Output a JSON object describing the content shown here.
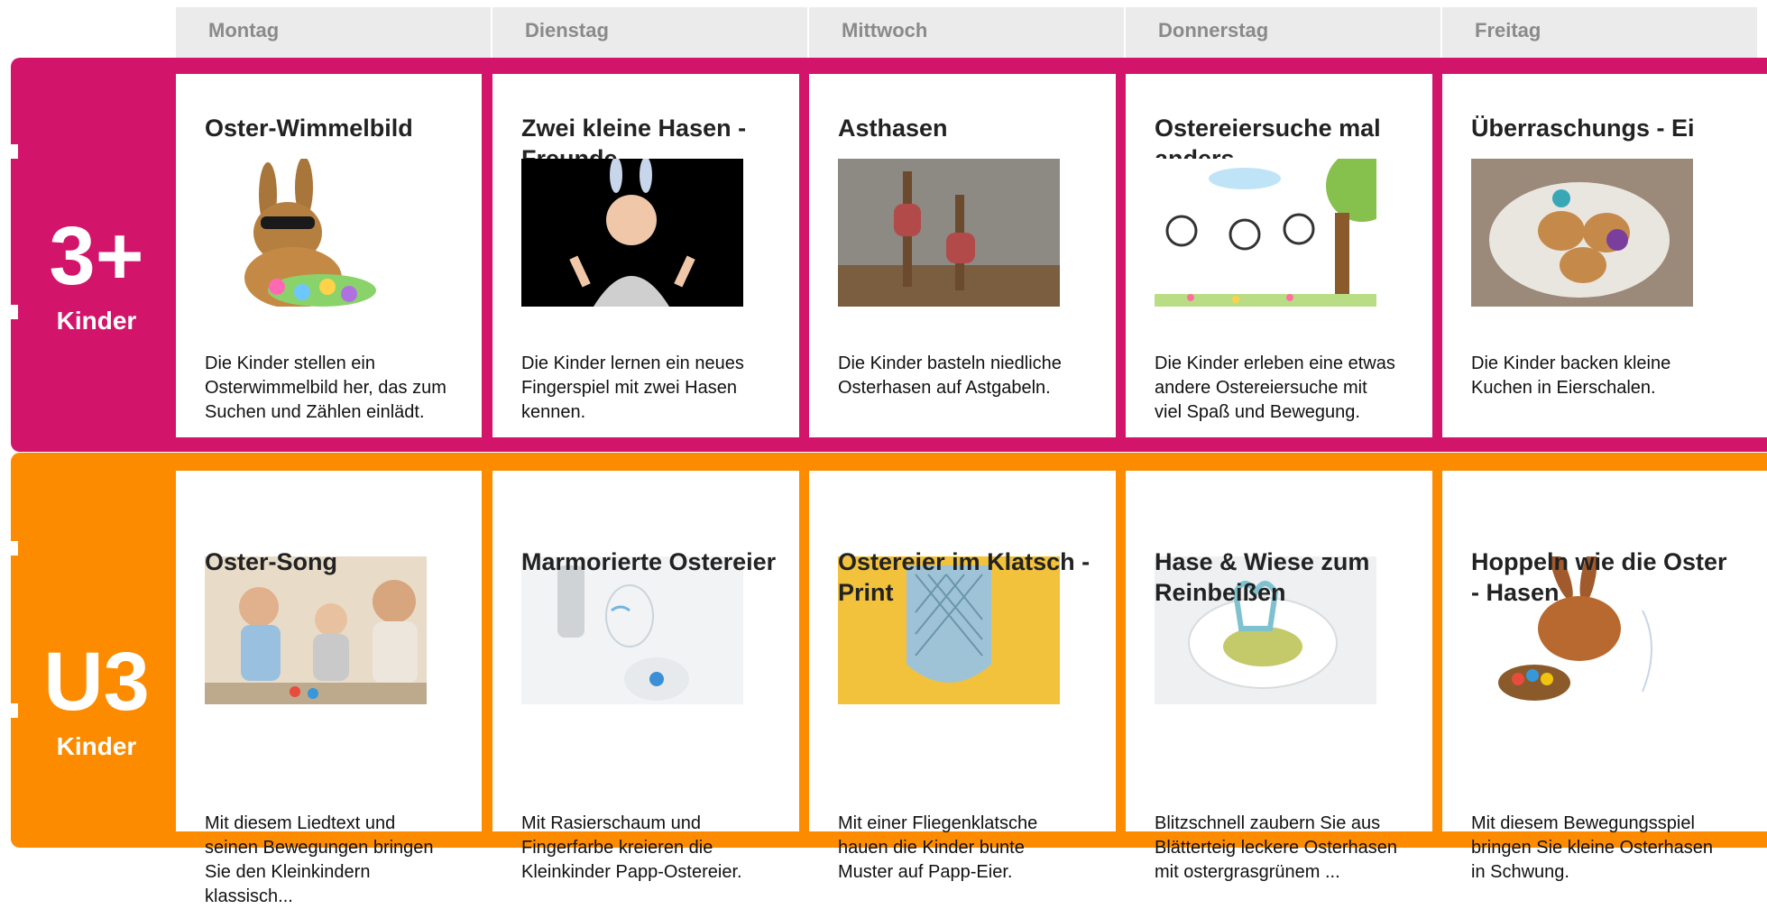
{
  "colors": {
    "pink": "#d2156b",
    "orange": "#fd8b00",
    "header_bg": "#ebebeb",
    "header_text": "#8a8a8a"
  },
  "days": [
    "Montag",
    "Dienstag",
    "Mittwoch",
    "Donnerstag",
    "Freitag"
  ],
  "groups": [
    {
      "big": "3+",
      "small": "Kinder",
      "cards": [
        {
          "title": "Oster-Wimmelbild",
          "image": "easter-bunny-with-eggs-image",
          "description": "Die Kinder stellen ein Osterwimmelbild her, das zum Suchen und Zählen einlädt."
        },
        {
          "title": "Zwei kleine Hasen - Freunde",
          "image": "child-with-bunny-ears-image",
          "description": "Die Kinder lernen ein neues Fingerspiel mit zwei Hasen kennen."
        },
        {
          "title": "Asthasen",
          "image": "branch-bunnies-image",
          "description": "Die Kinder basteln niedliche Osterhasen auf Astgabeln."
        },
        {
          "title": "Ostereiersuche mal anders",
          "image": "kids-drawing-image",
          "description": "Die Kinder erleben eine etwas andere Ostereiersuche mit viel Spaß und Bewegung."
        },
        {
          "title": "Überraschungs - Ei",
          "image": "eggshell-cakes-image",
          "description": "Die Kinder backen kleine Kuchen in Eierschalen."
        }
      ]
    },
    {
      "big": "U3",
      "small": "Kinder",
      "cards": [
        {
          "title": "Oster-Song",
          "image": "toddlers-playing-image",
          "description": "Mit diesem Liedtext und seinen Bewegungen bringen Sie den Kleinkindern klassisch..."
        },
        {
          "title": "Marmorierte Ostereier",
          "image": "shaving-foam-eggs-image",
          "description": "Mit Rasierschaum und Fingerfarbe kreieren die Kleinkinder Papp-Ostereier."
        },
        {
          "title": "Ostereier im Klatsch - Print",
          "image": "fly-swatter-image",
          "description": "Mit einer Fliegenklatsche hauen die Kinder bunte Muster auf Papp-Eier."
        },
        {
          "title": "Hase & Wiese zum Reinbeißen",
          "image": "puff-pastry-bunny-image",
          "description": "Blitzschnell zaubern Sie aus Blätterteig leckere Osterhasen mit ostergrasgrünem ..."
        },
        {
          "title": "Hoppeln wie die Oster - Hasen",
          "image": "hopping-bunny-drawing-image",
          "description": "Mit diesem Bewegungsspiel bringen Sie kleine Osterhasen in Schwung."
        }
      ]
    }
  ]
}
